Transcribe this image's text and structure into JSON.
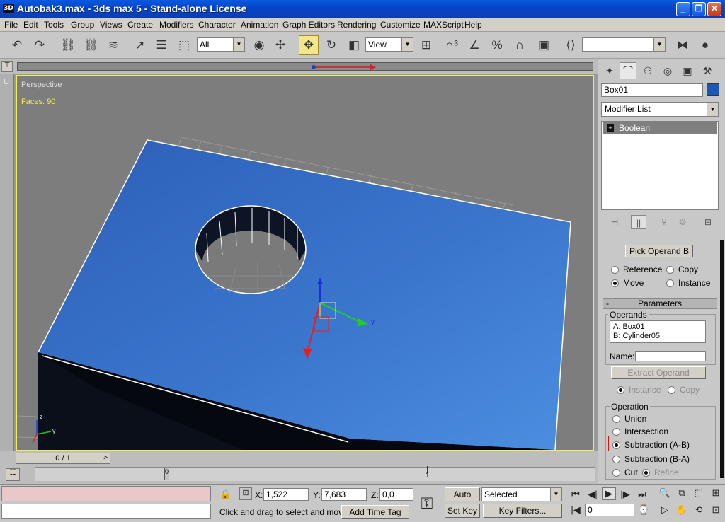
{
  "window": {
    "title": "Autobak3.max - 3ds max 5 - Stand-alone License",
    "app_icon_text": "3D"
  },
  "menu": [
    "File",
    "Edit",
    "Tools",
    "Group",
    "Views",
    "Create",
    "Modifiers",
    "Character",
    "Animation",
    "Graph Editors",
    "Rendering",
    "Customize",
    "MAXScript",
    "Help"
  ],
  "toolbar": {
    "selection_filter": "All",
    "reference_coord": "View",
    "named_selection": ""
  },
  "viewport": {
    "label": "Perspective",
    "faces": "Faces: 90",
    "axis_x": "x",
    "axis_y": "y",
    "axis_z": "z"
  },
  "command_panel": {
    "object_name": "Box01",
    "color": "#1a58b4",
    "modifier_list": "Modifier List",
    "stack_item": "Boolean",
    "pick_operand_button": "Pick Operand B",
    "pick_options": {
      "reference": "Reference",
      "copy": "Copy",
      "move": "Move",
      "instance": "Instance"
    },
    "parameters_title": "Parameters",
    "operands_label": "Operands",
    "operands": [
      "A: Box01",
      "B: Cylinder05"
    ],
    "name_label": "Name:",
    "extract_operand_button": "Extract Operand",
    "extract_options": {
      "instance": "Instance",
      "copy": "Copy"
    },
    "operation_label": "Operation",
    "operations": {
      "union": "Union",
      "intersection": "Intersection",
      "subtraction_ab": "Subtraction (A-B)",
      "subtraction_ba": "Subtraction (B-A)",
      "cut": "Cut",
      "refine": "Refine"
    }
  },
  "timeline": {
    "frame_display": "0 / 1",
    "tick_zero": "0",
    "tick_one": "1"
  },
  "status": {
    "x_label": "X:",
    "x_value": "1,522",
    "y_label": "Y:",
    "y_value": "7,683",
    "z_label": "Z:",
    "z_value": "0,0",
    "prompt": "Click and drag to select and move",
    "add_time_tag": "Add Time Tag",
    "auto_key": "Auto Key",
    "set_key": "Set Key",
    "key_mode_select": "Selected",
    "key_filters": "Key Filters...",
    "current_frame": "0"
  }
}
